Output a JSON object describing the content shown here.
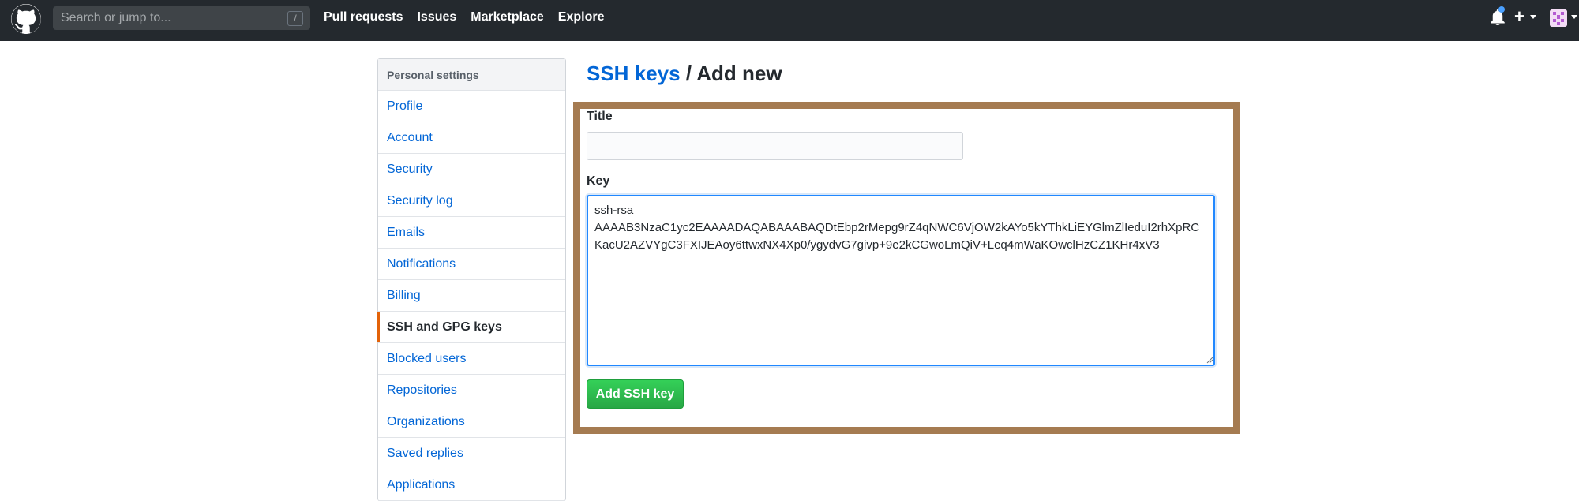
{
  "header": {
    "search_placeholder": "Search or jump to...",
    "slash_key": "/",
    "nav": [
      "Pull requests",
      "Issues",
      "Marketplace",
      "Explore"
    ],
    "plus_glyph": "+",
    "notification_dot_color": "#4aa0ff",
    "icons": [
      "github-logo-icon",
      "bell-icon",
      "plus-icon",
      "caret-down-icon",
      "avatar"
    ]
  },
  "sidebar": {
    "heading": "Personal settings",
    "items": [
      {
        "label": "Profile"
      },
      {
        "label": "Account"
      },
      {
        "label": "Security"
      },
      {
        "label": "Security log"
      },
      {
        "label": "Emails"
      },
      {
        "label": "Notifications"
      },
      {
        "label": "Billing"
      },
      {
        "label": "SSH and GPG keys",
        "active": true
      },
      {
        "label": "Blocked users"
      },
      {
        "label": "Repositories"
      },
      {
        "label": "Organizations"
      },
      {
        "label": "Saved replies"
      },
      {
        "label": "Applications"
      }
    ],
    "active_accent": "#e36209"
  },
  "main": {
    "title_link": "SSH keys",
    "title_rest": " / Add new",
    "title_label": "Title",
    "title_value": "",
    "key_label": "Key",
    "key_value": "ssh-rsa\nAAAAB3NzaC1yc2EAAAADAQABAAABAQDtEbp2rMepg9rZ4qNWC6VjOW2kAYo5kYThkLiEYGlmZlIeduI2rhXpRCKacU2AZVYgC3FXIJEAoy6ttwxNX4Xp0/ygydvG7givp+9e2kCGwoLmQiV+Leq4mWaKOwclHzCZ1KHr4xV3",
    "submit_label": "Add SSH key",
    "highlight_color": "#a57b51",
    "link_color": "#0366d6",
    "button_color": "#28a745"
  }
}
